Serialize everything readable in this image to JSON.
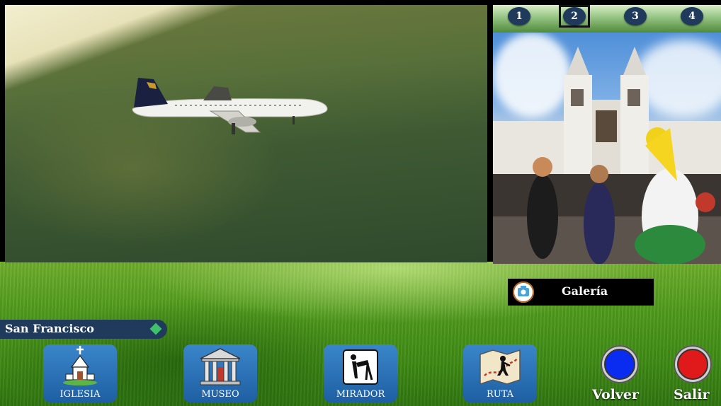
{
  "thumbs": [
    "1",
    "2",
    "3",
    "4"
  ],
  "selected_thumb": "2",
  "gallery_button": {
    "label": "Galería",
    "icon": "camera-icon"
  },
  "location": {
    "label": "San Francisco"
  },
  "nav": [
    {
      "label": "IGLESIA",
      "icon": "church-icon"
    },
    {
      "label": "MUSEO",
      "icon": "museum-icon"
    },
    {
      "label": "MIRADOR",
      "icon": "viewpoint-icon"
    },
    {
      "label": "RUTA",
      "icon": "route-map-icon"
    }
  ],
  "actions": {
    "volver": {
      "label": "Volver",
      "color": "#0a2cf0"
    },
    "salir": {
      "label": "Salir",
      "color": "#e01a1a"
    }
  }
}
